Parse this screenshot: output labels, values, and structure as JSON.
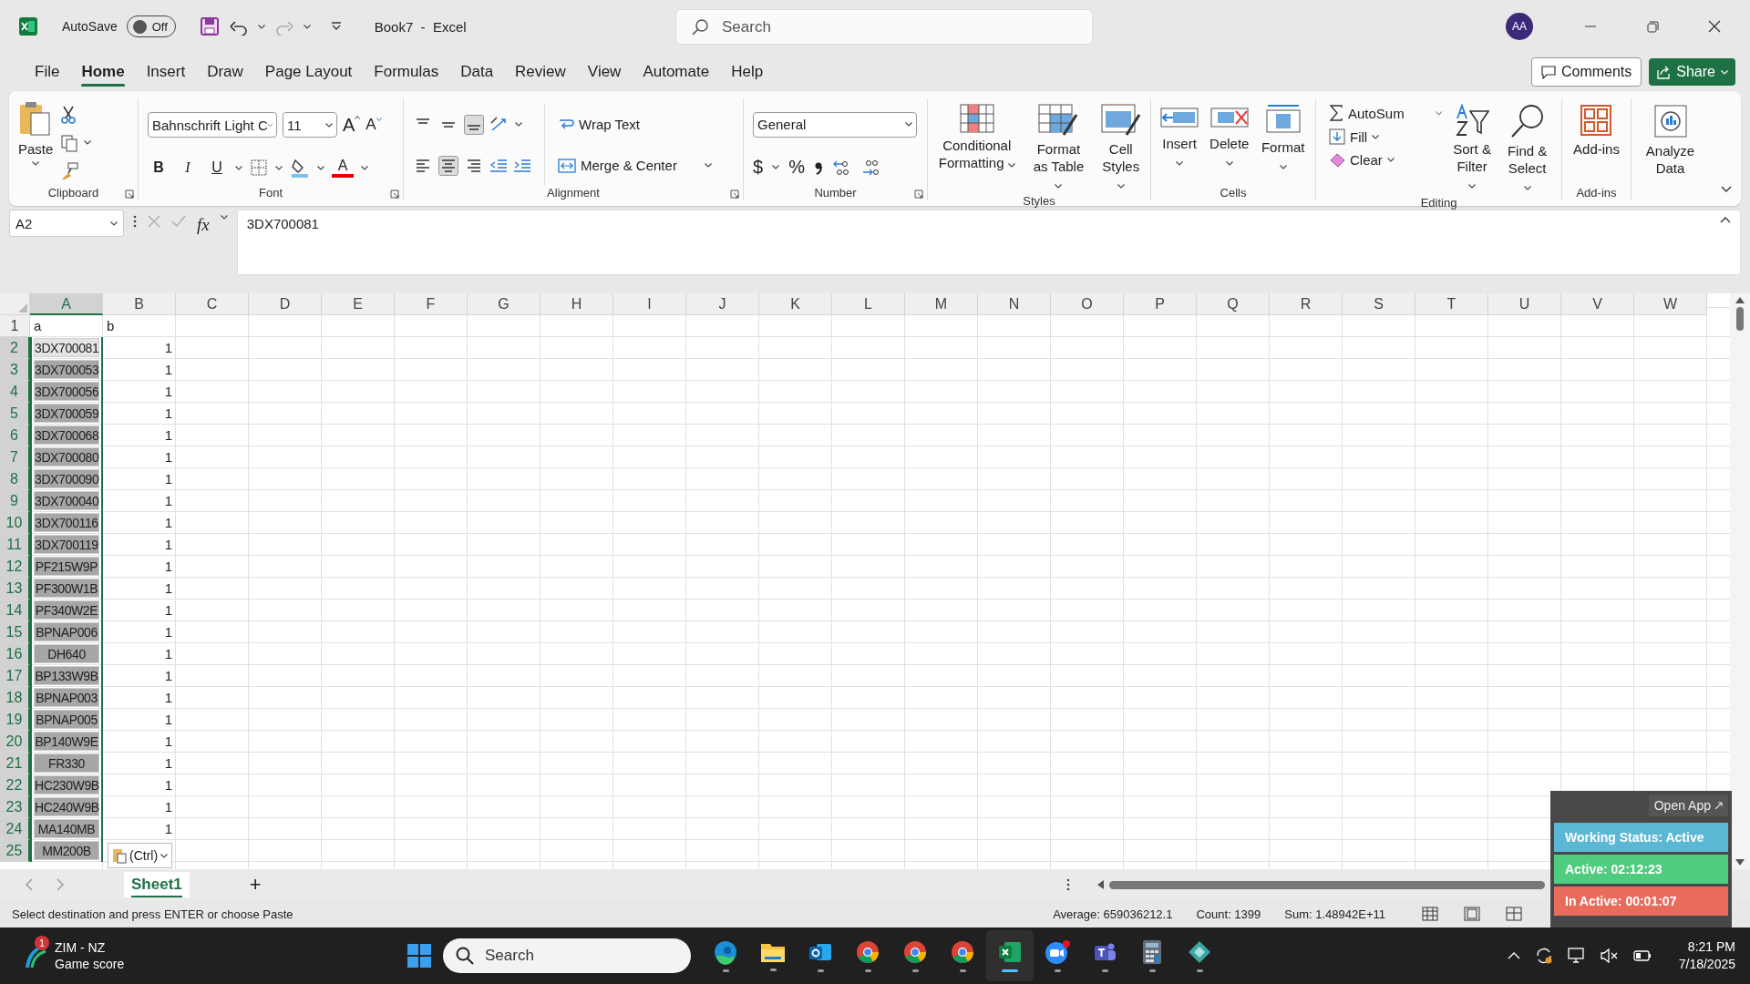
{
  "title_bar": {
    "autosave_label": "AutoSave",
    "autosave": {
      "label": "Off",
      "on": false
    },
    "title": "Book7  -  Excel",
    "search_placeholder": "Search",
    "avatar": "AA"
  },
  "menu_tabs": [
    {
      "label": "File",
      "selected": false
    },
    {
      "label": "Home",
      "selected": true
    },
    {
      "label": "Insert",
      "selected": false
    },
    {
      "label": "Draw",
      "selected": false
    },
    {
      "label": "Page Layout",
      "selected": false
    },
    {
      "label": "Formulas",
      "selected": false
    },
    {
      "label": "Data",
      "selected": false
    },
    {
      "label": "Review",
      "selected": false
    },
    {
      "label": "View",
      "selected": false
    },
    {
      "label": "Automate",
      "selected": false
    },
    {
      "label": "Help",
      "selected": false
    }
  ],
  "comments_button": "Comments",
  "share_button": "Share",
  "ribbon": {
    "clipboard": {
      "label": "Clipboard",
      "paste": "Paste"
    },
    "font": {
      "label": "Font",
      "font_name": "Bahnschrift Light C",
      "font_size": "11",
      "grow": "A",
      "shrink": "A",
      "bold": "B",
      "italic": "I",
      "underline": "U",
      "font_color": "A"
    },
    "alignment": {
      "label": "Alignment",
      "wrap_text": "Wrap Text",
      "merge": "Merge & Center",
      "vertical": [
        {
          "kind": "top",
          "selected": false
        },
        {
          "kind": "middle",
          "selected": false
        },
        {
          "kind": "bottom",
          "selected": true
        }
      ],
      "horizontal": [
        {
          "kind": "left",
          "selected": false
        },
        {
          "kind": "center",
          "selected": true
        },
        {
          "kind": "right",
          "selected": false
        }
      ]
    },
    "number": {
      "label": "Number",
      "format": "General",
      "currency": "$",
      "percent": "%"
    },
    "styles": {
      "label": "Styles",
      "buttons": [
        {
          "kind": "conditional",
          "label": "Conditional Formatting"
        },
        {
          "kind": "table",
          "label": "Format as Table"
        },
        {
          "kind": "cell_styles",
          "label": "Cell Styles"
        }
      ]
    },
    "cells": {
      "label": "Cells",
      "buttons": [
        {
          "kind": "insert",
          "label": "Insert"
        },
        {
          "kind": "delete",
          "label": "Delete"
        },
        {
          "kind": "format",
          "label": "Format"
        }
      ]
    },
    "editing": {
      "label": "Editing",
      "autosum": "AutoSum",
      "fill": "Fill",
      "clear": "Clear",
      "buttons": [
        {
          "kind": "sort",
          "label": "Sort & Filter"
        },
        {
          "kind": "find",
          "label": "Find & Select"
        }
      ]
    },
    "addins": {
      "label": "Add-ins",
      "button": "Add-ins"
    },
    "analyze": {
      "button": "Analyze Data"
    }
  },
  "formula_bar": {
    "name_box": "A2",
    "fx": "fx",
    "formula": "3DX700081"
  },
  "sheet": {
    "columns": [
      {
        "label": "A",
        "selected": true
      },
      {
        "label": "B",
        "selected": false
      },
      {
        "label": "C",
        "selected": false
      },
      {
        "label": "D",
        "selected": false
      },
      {
        "label": "E",
        "selected": false
      },
      {
        "label": "F",
        "selected": false
      },
      {
        "label": "G",
        "selected": false
      },
      {
        "label": "H",
        "selected": false
      },
      {
        "label": "I",
        "selected": false
      },
      {
        "label": "J",
        "selected": false
      },
      {
        "label": "K",
        "selected": false
      },
      {
        "label": "L",
        "selected": false
      },
      {
        "label": "M",
        "selected": false
      },
      {
        "label": "N",
        "selected": false
      },
      {
        "label": "O",
        "selected": false
      },
      {
        "label": "P",
        "selected": false
      },
      {
        "label": "Q",
        "selected": false
      },
      {
        "label": "R",
        "selected": false
      },
      {
        "label": "S",
        "selected": false
      },
      {
        "label": "T",
        "selected": false
      },
      {
        "label": "U",
        "selected": false
      },
      {
        "label": "V",
        "selected": false
      },
      {
        "label": "W",
        "selected": false
      }
    ],
    "rows": [
      {
        "number": "1",
        "a": "a",
        "b": "b",
        "kind": "heading",
        "selected": false,
        "active": false
      },
      {
        "number": "2",
        "a": "3DX700081",
        "b": "1",
        "kind": "data",
        "selected": true,
        "active": true
      },
      {
        "number": "3",
        "a": "3DX700053",
        "b": "1",
        "kind": "data",
        "selected": true,
        "active": false
      },
      {
        "number": "4",
        "a": "3DX700056",
        "b": "1",
        "kind": "data",
        "selected": true,
        "active": false
      },
      {
        "number": "5",
        "a": "3DX700059",
        "b": "1",
        "kind": "data",
        "selected": true,
        "active": false
      },
      {
        "number": "6",
        "a": "3DX700068",
        "b": "1",
        "kind": "data",
        "selected": true,
        "active": false
      },
      {
        "number": "7",
        "a": "3DX700080",
        "b": "1",
        "kind": "data",
        "selected": true,
        "active": false
      },
      {
        "number": "8",
        "a": "3DX700090",
        "b": "1",
        "kind": "data",
        "selected": true,
        "active": false
      },
      {
        "number": "9",
        "a": "3DX700040",
        "b": "1",
        "kind": "data",
        "selected": true,
        "active": false
      },
      {
        "number": "10",
        "a": "3DX700116",
        "b": "1",
        "kind": "data",
        "selected": true,
        "active": false
      },
      {
        "number": "11",
        "a": "3DX700119",
        "b": "1",
        "kind": "data",
        "selected": true,
        "active": false
      },
      {
        "number": "12",
        "a": "PF215W9P",
        "b": "1",
        "kind": "data",
        "selected": true,
        "active": false
      },
      {
        "number": "13",
        "a": "PF300W1B",
        "b": "1",
        "kind": "data",
        "selected": true,
        "active": false
      },
      {
        "number": "14",
        "a": "PF340W2E",
        "b": "1",
        "kind": "data",
        "selected": true,
        "active": false
      },
      {
        "number": "15",
        "a": "BPNAP006",
        "b": "1",
        "kind": "data",
        "selected": true,
        "active": false
      },
      {
        "number": "16",
        "a": "DH640",
        "b": "1",
        "kind": "data",
        "selected": true,
        "active": false
      },
      {
        "number": "17",
        "a": "BP133W9B",
        "b": "1",
        "kind": "data",
        "selected": true,
        "active": false
      },
      {
        "number": "18",
        "a": "BPNAP003",
        "b": "1",
        "kind": "data",
        "selected": true,
        "active": false
      },
      {
        "number": "19",
        "a": "BPNAP005",
        "b": "1",
        "kind": "data",
        "selected": true,
        "active": false
      },
      {
        "number": "20",
        "a": "BP140W9E",
        "b": "1",
        "kind": "data",
        "selected": true,
        "active": false
      },
      {
        "number": "21",
        "a": "FR330",
        "b": "1",
        "kind": "data",
        "selected": true,
        "active": false
      },
      {
        "number": "22",
        "a": "HC230W9B",
        "b": "1",
        "kind": "data",
        "selected": true,
        "active": false
      },
      {
        "number": "23",
        "a": "HC240W9B",
        "b": "1",
        "kind": "data",
        "selected": true,
        "active": false
      },
      {
        "number": "24",
        "a": "MA140MB",
        "b": "1",
        "kind": "data",
        "selected": true,
        "active": false
      },
      {
        "number": "25",
        "a": "MM200B",
        "kind": "data",
        "selected": true,
        "active": false
      }
    ],
    "paste_options": "(Ctrl)"
  },
  "sheet_tabs": [
    {
      "label": "Sheet1",
      "selected": true
    }
  ],
  "add_sheet": "+",
  "status_bar": {
    "message": "Select destination and press ENTER or choose Paste",
    "average": "Average: 659036212.1",
    "count": "Count: 1399",
    "sum": "Sum: 1.48942E+11"
  },
  "tracker": {
    "open_app": "Open App",
    "rows": [
      {
        "label": "Working Status: Active",
        "color": "#5bb8d4"
      },
      {
        "label": "Active: 02:12:23",
        "color": "#4fcc7e"
      },
      {
        "label": "In Active: 00:01:07",
        "color": "#e96b5c"
      }
    ]
  },
  "taskbar": {
    "weather_badge": "1",
    "weather_title": "ZIM - NZ",
    "weather_subtitle": "Game score",
    "search_placeholder": "Search",
    "apps": [
      {
        "kind": "edge",
        "selected": false
      },
      {
        "kind": "explorer",
        "selected": false
      },
      {
        "kind": "outlook",
        "selected": false
      },
      {
        "kind": "chrome",
        "selected": false
      },
      {
        "kind": "chrome",
        "selected": false
      },
      {
        "kind": "chrome",
        "selected": false
      },
      {
        "kind": "excel",
        "selected": true
      },
      {
        "kind": "zoom",
        "selected": false
      },
      {
        "kind": "teams",
        "selected": false
      },
      {
        "kind": "calculator",
        "selected": false
      },
      {
        "kind": "diamond",
        "selected": false
      }
    ],
    "time": "8:21 PM",
    "date": "7/18/2025"
  }
}
